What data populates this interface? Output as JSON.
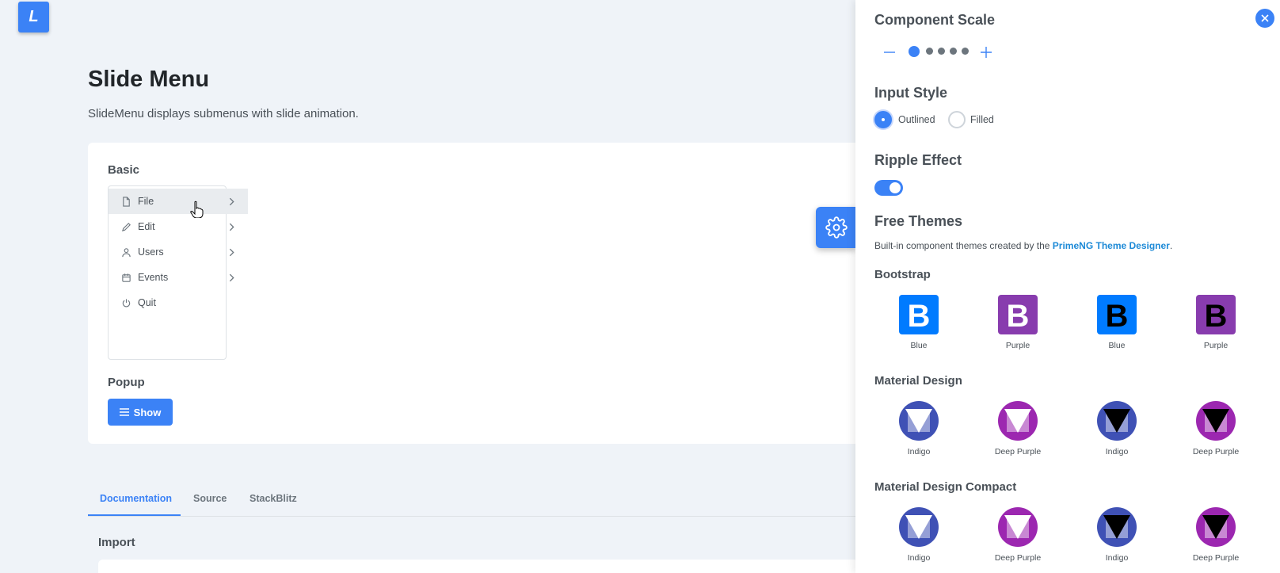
{
  "logo": {
    "letter": "L"
  },
  "page": {
    "title": "Slide Menu",
    "subtitle": "SlideMenu displays submenus with slide animation."
  },
  "basic": {
    "title": "Basic",
    "items": [
      {
        "label": "File",
        "icon": "file-icon",
        "has_submenu": true,
        "active": true
      },
      {
        "label": "Edit",
        "icon": "pencil-icon",
        "has_submenu": true
      },
      {
        "label": "Users",
        "icon": "user-icon",
        "has_submenu": true
      },
      {
        "label": "Events",
        "icon": "calendar-icon",
        "has_submenu": true
      },
      {
        "label": "Quit",
        "icon": "power-icon",
        "has_submenu": false
      }
    ]
  },
  "popup": {
    "title": "Popup",
    "button_label": "Show",
    "button_icon": "bars-icon"
  },
  "tabs": [
    {
      "label": "Documentation",
      "active": true
    },
    {
      "label": "Source"
    },
    {
      "label": "StackBlitz"
    }
  ],
  "import": {
    "title": "Import"
  },
  "config": {
    "scale": {
      "title": "Component Scale",
      "steps": 5,
      "selected": 1
    },
    "input_style": {
      "title": "Input Style",
      "options": [
        {
          "label": "Outlined",
          "selected": true
        },
        {
          "label": "Filled",
          "selected": false
        }
      ]
    },
    "ripple": {
      "title": "Ripple Effect",
      "enabled": true
    },
    "free_themes": {
      "title": "Free Themes",
      "desc_prefix": "Built-in component themes created by the ",
      "desc_link": "PrimeNG Theme Designer",
      "desc_suffix": "."
    },
    "groups": [
      {
        "title": "Bootstrap",
        "kind": "bootstrap",
        "themes": [
          {
            "label": "Blue",
            "color": "#007bff",
            "letter_color": "#ffffff"
          },
          {
            "label": "Purple",
            "color": "#883cae",
            "letter_color": "#ffffff"
          },
          {
            "label": "Blue",
            "color": "#007bff",
            "letter_color": "#000000"
          },
          {
            "label": "Purple",
            "color": "#883cae",
            "letter_color": "#000000"
          }
        ]
      },
      {
        "title": "Material Design",
        "kind": "material",
        "themes": [
          {
            "label": "Indigo",
            "color": "#3f51b5",
            "mark_color": "#ffffff"
          },
          {
            "label": "Deep Purple",
            "color": "#9c27b0",
            "mark_color": "#ffffff"
          },
          {
            "label": "Indigo",
            "color": "#3f51b5",
            "mark_color": "#000000"
          },
          {
            "label": "Deep Purple",
            "color": "#9c27b0",
            "mark_color": "#000000"
          }
        ]
      },
      {
        "title": "Material Design Compact",
        "kind": "material",
        "themes": [
          {
            "label": "Indigo",
            "color": "#3f51b5",
            "mark_color": "#ffffff"
          },
          {
            "label": "Deep Purple",
            "color": "#9c27b0",
            "mark_color": "#ffffff"
          },
          {
            "label": "Indigo",
            "color": "#3f51b5",
            "mark_color": "#000000"
          },
          {
            "label": "Deep Purple",
            "color": "#9c27b0",
            "mark_color": "#000000"
          }
        ]
      }
    ]
  },
  "colors": {
    "accent": "#3b82f6",
    "link": "#1d8ad7"
  }
}
